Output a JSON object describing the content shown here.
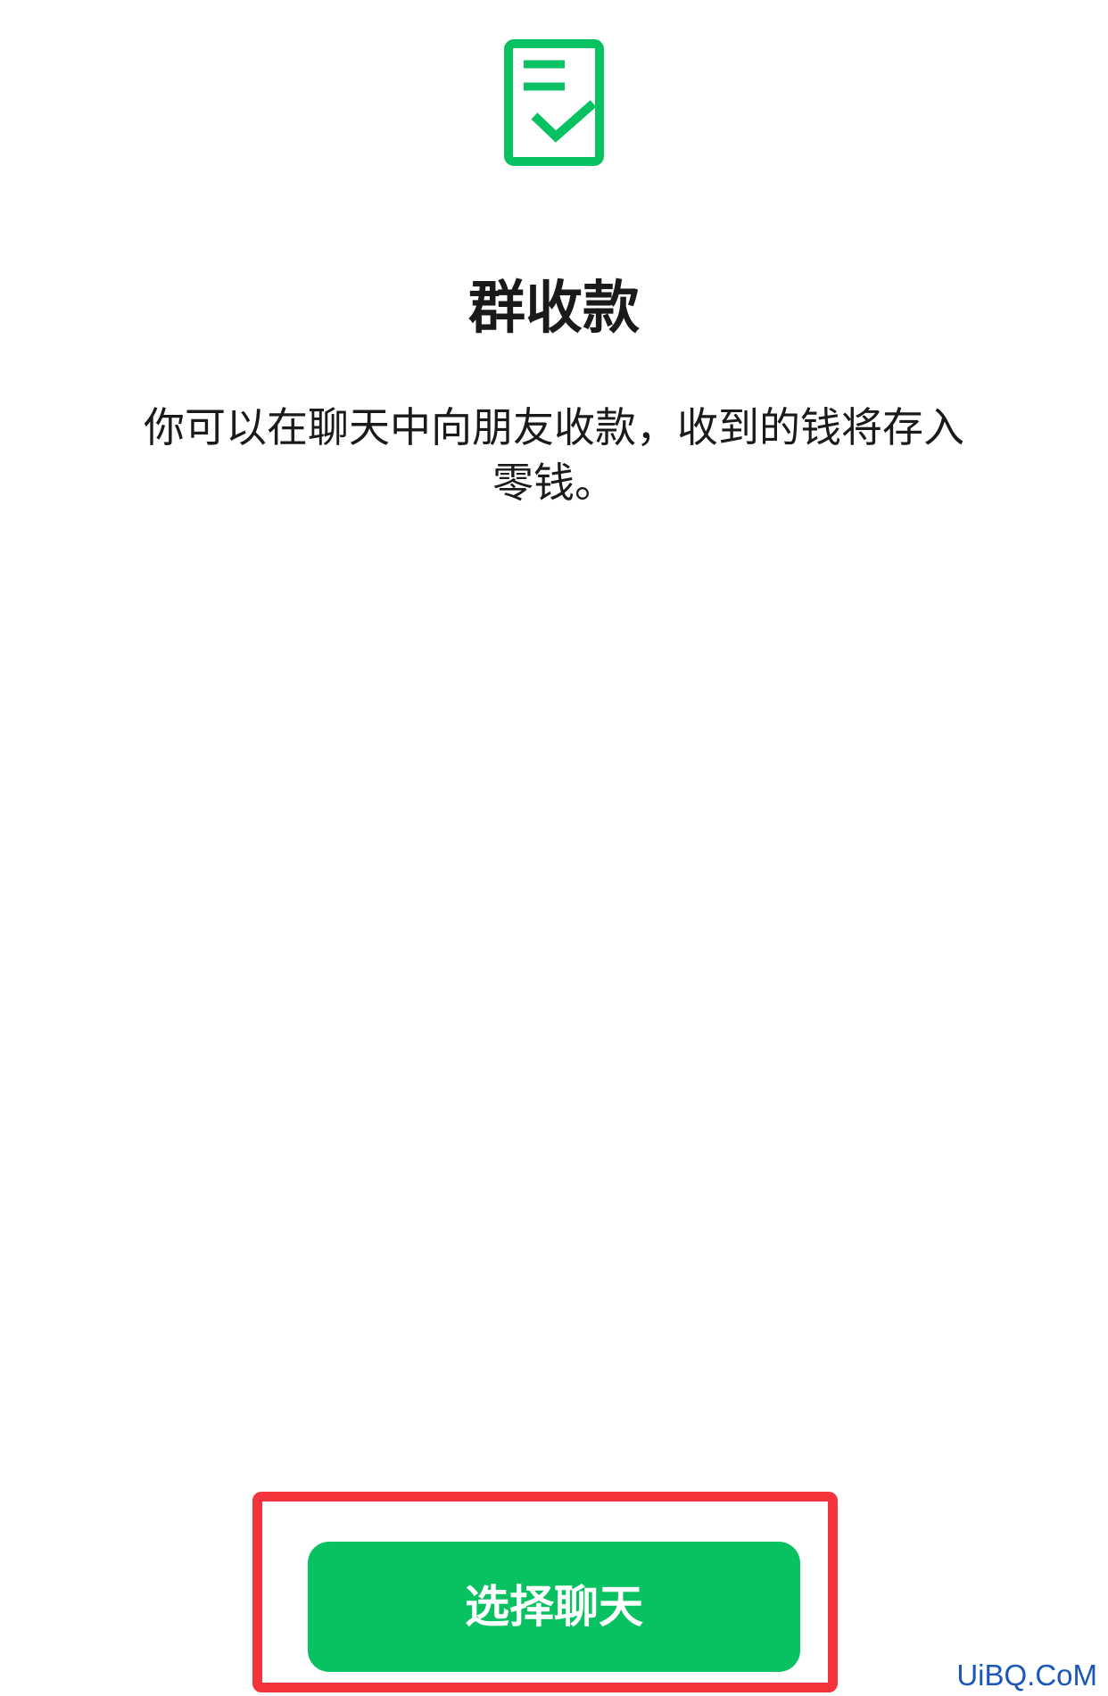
{
  "colors": {
    "accent": "#08c160",
    "highlight": "#f5333a",
    "text": "#1a1a1a",
    "watermark": "#1a57b8"
  },
  "icon": {
    "name": "receipt-check-icon"
  },
  "header": {
    "title": "群收款"
  },
  "body": {
    "description": "你可以在聊天中向朋友收款，收到的钱将存入零钱。"
  },
  "action": {
    "button_label": "选择聊天"
  },
  "watermark": {
    "text": "UiBQ.CoM"
  }
}
